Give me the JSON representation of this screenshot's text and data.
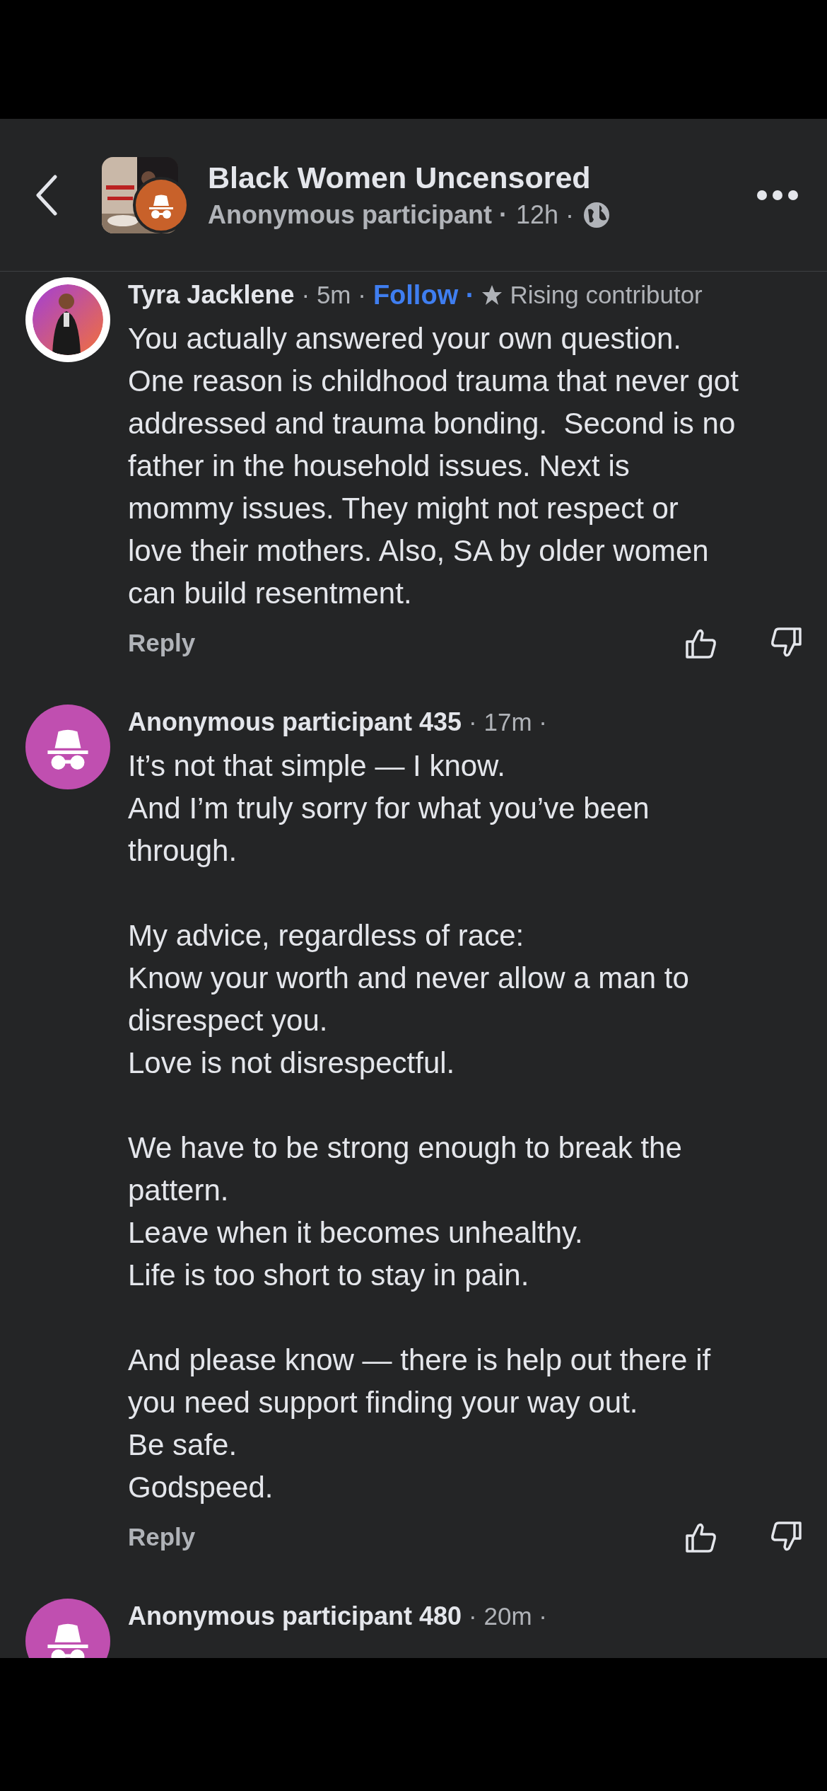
{
  "group": {
    "title": "Black Women Uncensored",
    "author": "Anonymous participant ·",
    "time": "12h ·"
  },
  "comments": [
    {
      "name": "Tyra Jacklene",
      "time": "· 5m ·",
      "follow": "Follow ·",
      "badge": "Rising contributor",
      "text": "You actually answered your own question.\nOne reason is childhood trauma that never got\naddressed and trauma bonding.  Second is no\nfather in the household issues. Next is\nmommy issues. They might not respect or\nlove their mothers. Also, SA by older women\ncan build resentment.",
      "reply": "Reply"
    },
    {
      "avatar": {
        "kind": "anonymous"
      },
      "name": "Anonymous participant 435",
      "time": "· 17m ·",
      "text": "It’s not that simple — I know.\nAnd I’m truly sorry for what you’ve been\nthrough.\n\nMy advice, regardless of race:\nKnow your worth and never allow a man to\ndisrespect you.\nLove is not disrespectful.\n\nWe have to be strong enough to break the\npattern.\nLeave when it becomes unhealthy.\nLife is too short to stay in pain.\n\nAnd please know — there is help out there if\nyou need support finding your way out.\nBe safe.\nGodspeed.",
      "reply": "Reply"
    },
    {
      "avatar": {
        "kind": "anonymous"
      },
      "name": "Anonymous participant 480",
      "time": "· 20m ·"
    }
  ]
}
